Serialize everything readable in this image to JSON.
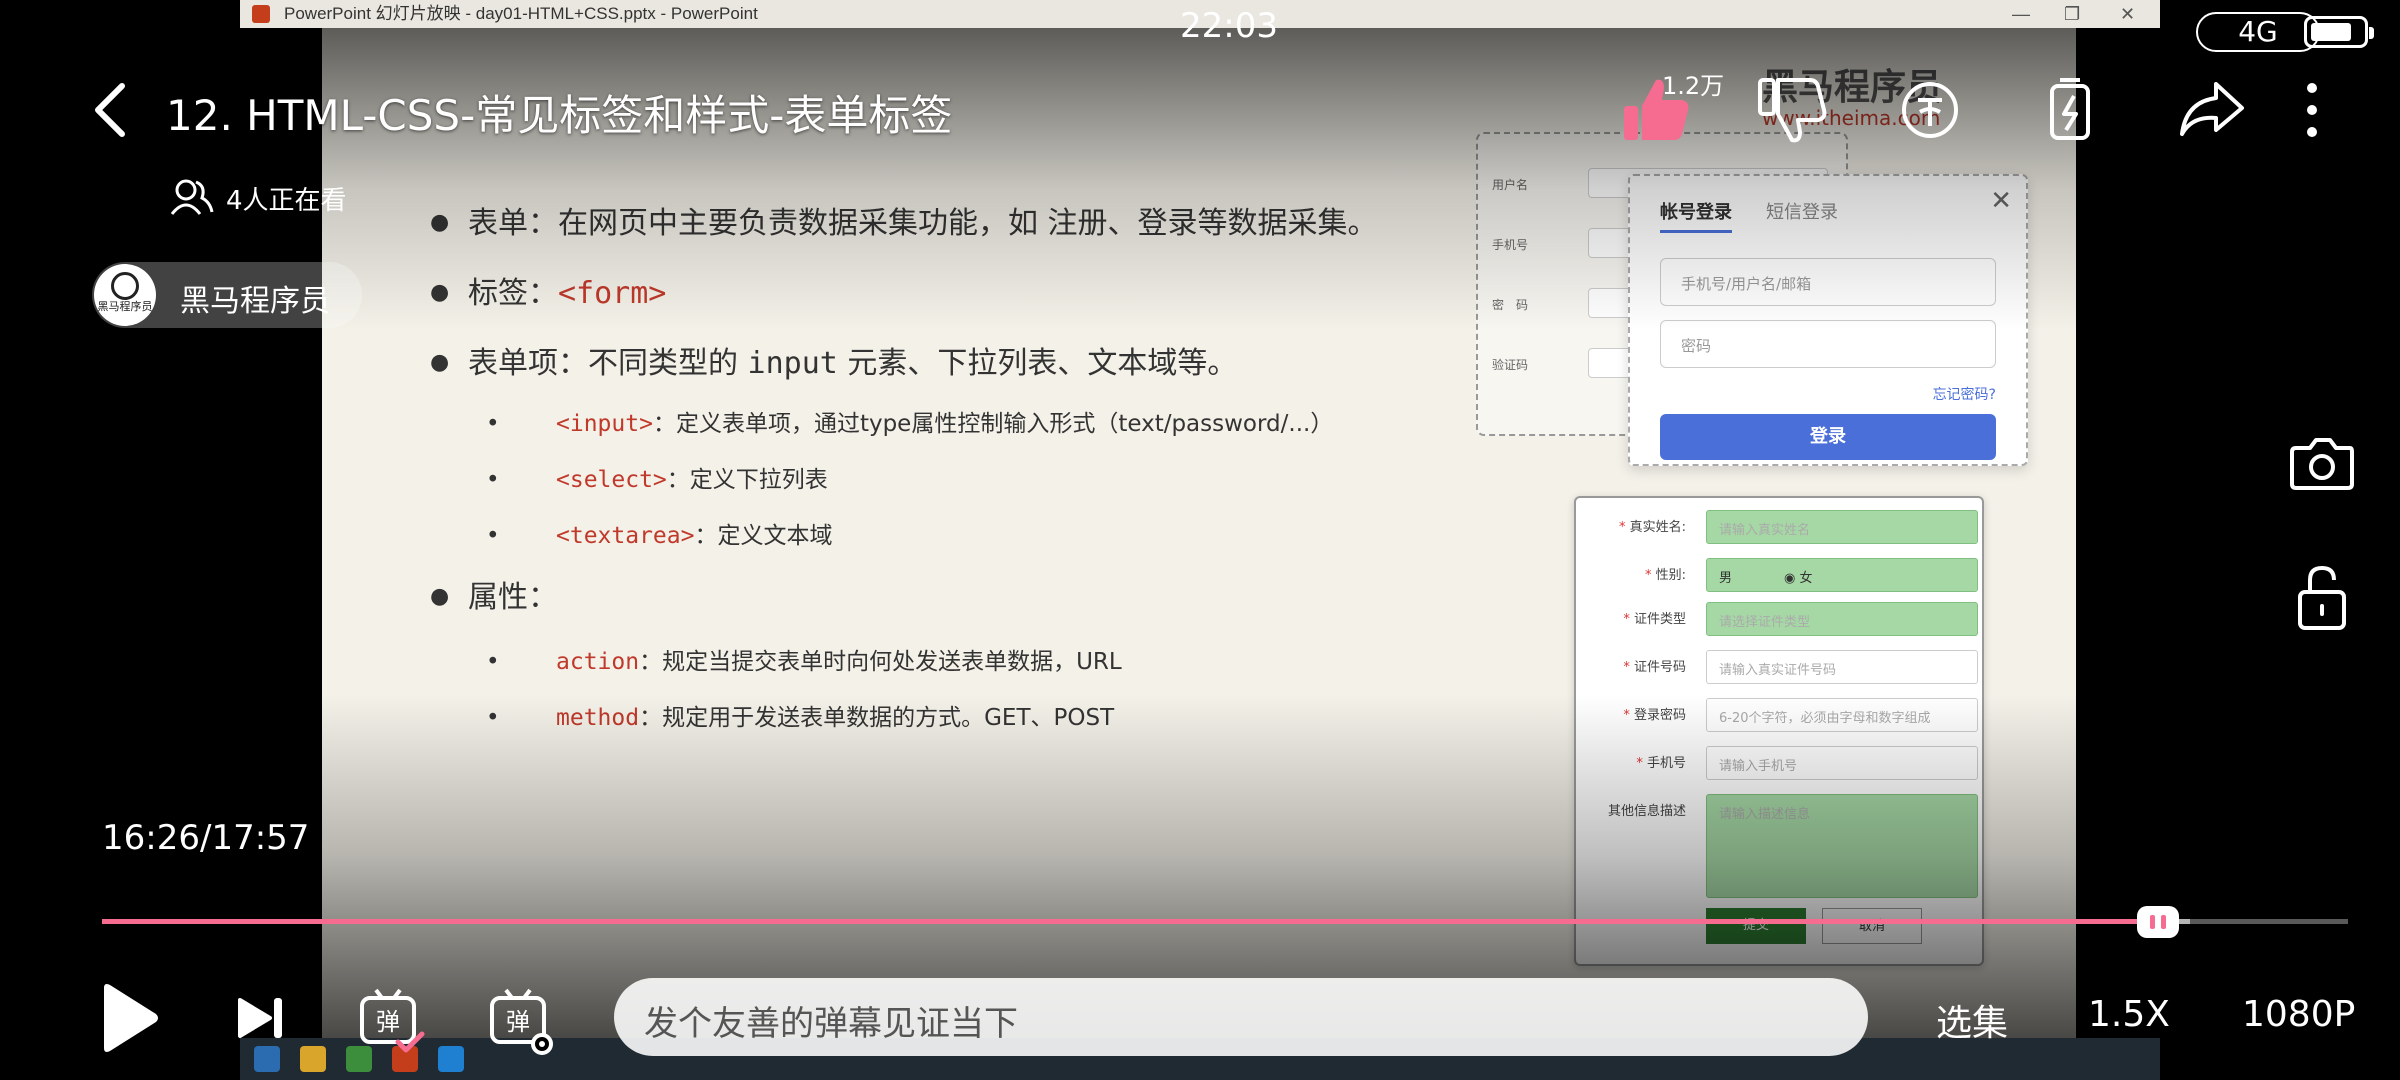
{
  "status_bar": {
    "time": "22:03",
    "network": "4G"
  },
  "powerpoint": {
    "window_title": "PowerPoint 幻灯片放映 - day01-HTML+CSS.pptx - PowerPoint",
    "slide": {
      "bullets": [
        {
          "label": "表单：在网页中主要负责数据采集功能，如 注册、登录等数据采集。"
        },
        {
          "pre": "标签：",
          "code": "<form>"
        },
        {
          "pre": "表单项：不同类型的 ",
          "mono": "input",
          "post": " 元素、下拉列表、文本域等。"
        },
        {
          "code": "<input>",
          "post": "：定义表单项，通过type属性控制输入形式（text/password/...）"
        },
        {
          "code": "<select>",
          "post": "：定义下拉列表"
        },
        {
          "code": "<textarea>",
          "post": "：定义文本域"
        },
        {
          "label": "属性："
        },
        {
          "code": "action",
          "post": "：规定当提交表单时向何处发送表单数据，URL"
        },
        {
          "code": "method",
          "post": "：规定用于发送表单数据的方式。GET、POST"
        }
      ],
      "logo": {
        "brand": "黑马程序员",
        "url": "www.itheima.com"
      },
      "register_form": {
        "labels": [
          "用户名",
          "手机号",
          "密　码",
          "验证码"
        ]
      },
      "login_card": {
        "tabs": [
          "帐号登录",
          "短信登录"
        ],
        "username_placeholder": "手机号/用户名/邮箱",
        "password_placeholder": "密码",
        "forgot": "忘记密码?",
        "submit": "登录"
      },
      "info_form": {
        "rows": [
          {
            "label": "真实姓名:",
            "required": true,
            "placeholder": "请输入真实姓名"
          },
          {
            "label": "性别:",
            "required": true,
            "placeholder": "男　　　　◉ 女"
          },
          {
            "label": "证件类型",
            "required": true,
            "placeholder": "请选择证件类型"
          },
          {
            "label": "证件号码",
            "required": true,
            "placeholder": "请输入真实证件号码"
          },
          {
            "label": "登录密码",
            "required": true,
            "placeholder": "6-20个字符，必须由字母和数字组成"
          },
          {
            "label": "手机号",
            "required": true,
            "placeholder": "请输入手机号"
          },
          {
            "label": "其他信息描述",
            "required": false,
            "placeholder": "请输入描述信息"
          }
        ],
        "ok": "提交",
        "cancel": "取消"
      }
    }
  },
  "player": {
    "title": "12. HTML-CSS-常见标签和样式-表单标签",
    "viewers": "4人正在看",
    "uploader": {
      "name": "黑马程序员",
      "avatar_text": "黑马程序员"
    },
    "likes": "1.2万",
    "current_time": "16:26",
    "duration": "17:57",
    "time_display": "16:26/17:57",
    "progress_fraction": 0.9155,
    "buffer_fraction": 0.9295,
    "danmaku_placeholder": "发个友善的弹幕见证当下",
    "episodes_label": "选集",
    "speed_label": "1.5X",
    "quality_label": "1080P",
    "accent_color": "#f56c90",
    "icons": [
      "back-arrow-icon",
      "viewers-icon",
      "like-icon",
      "dislike-icon",
      "coin-icon",
      "charge-icon",
      "share-icon",
      "more-icon",
      "screenshot-icon",
      "lock-icon",
      "play-icon",
      "next-icon",
      "danmaku-toggle-icon",
      "danmaku-settings-icon"
    ]
  }
}
